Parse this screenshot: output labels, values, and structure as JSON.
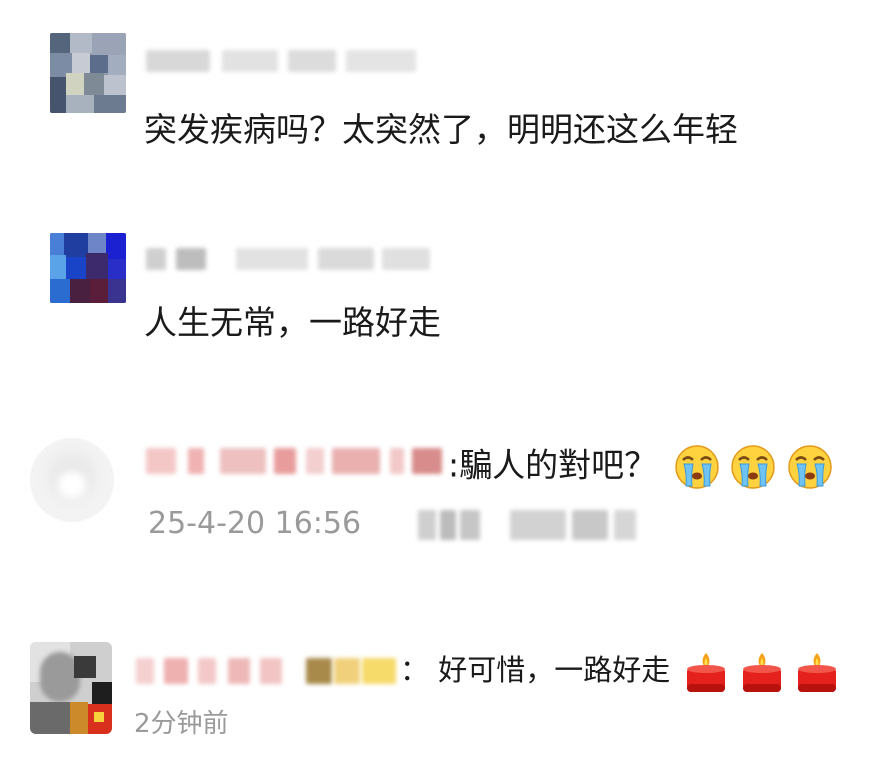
{
  "comments": [
    {
      "content": "突发疾病吗？太突然了，明明还这么年轻"
    },
    {
      "content": "人生无常，一路好走"
    },
    {
      "content": ":騙人的對吧？",
      "timestamp": "25-4-20 16:56",
      "emoji": [
        "crying-face",
        "crying-face",
        "crying-face"
      ]
    },
    {
      "content": "： 好可惜，一路好走",
      "timestamp": "2分钟前",
      "emoji": [
        "candle",
        "candle",
        "candle"
      ]
    }
  ]
}
